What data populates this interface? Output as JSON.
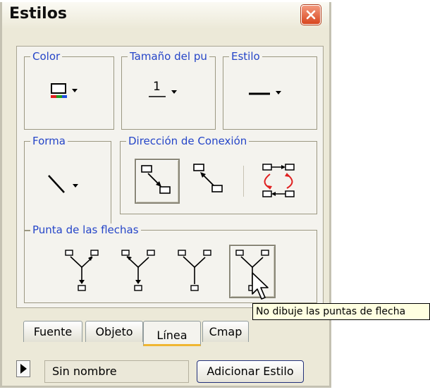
{
  "window": {
    "title": "Estilos"
  },
  "groups": {
    "color": "Color",
    "size": "Tamaño del pu",
    "style": "Estilo",
    "shape": "Forma",
    "direction": "Dirección de Conexión",
    "arrowheads": "Punta de las flechas"
  },
  "size_value": "1",
  "tabs": [
    "Fuente",
    "Objeto",
    "Línea",
    "Cmap"
  ],
  "active_tab": "Línea",
  "name_field": {
    "value": "Sin nombre"
  },
  "add_style_button": "Adicionar Estilo",
  "tooltip": "No dibuje las puntas de flecha",
  "colors": {
    "legend": "#2545c8",
    "close": "#d8461f",
    "active_tab": "#f0b632",
    "red_arrow": "#e02020"
  }
}
